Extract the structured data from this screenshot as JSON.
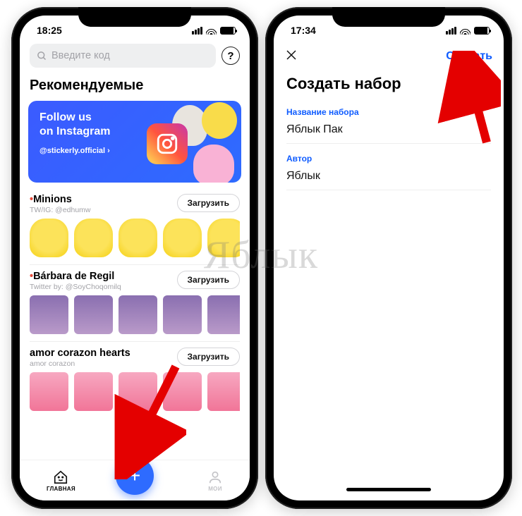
{
  "watermark": "Яблык",
  "left": {
    "status_time": "18:25",
    "search_placeholder": "Введите код",
    "section_recommended": "Рекомендуемые",
    "promo": {
      "line1": "Follow us",
      "line2": "on Instagram",
      "handle": "@stickerly.official ›"
    },
    "packs": [
      {
        "title": "Minions",
        "sub": "TW/IG: @edhumw",
        "button": "Загрузить"
      },
      {
        "title": "Bárbara de Regil",
        "sub": "Twitter by: @SoyChoqomilq",
        "button": "Загрузить"
      },
      {
        "title": "amor corazon hearts",
        "sub": "amor corazon",
        "button": "Загрузить"
      }
    ],
    "tabs": {
      "home": "ГЛАВНАЯ",
      "mine": "МОИ"
    }
  },
  "right": {
    "status_time": "17:34",
    "create": "Создать",
    "title": "Создать набор",
    "field_name_label": "Название набора",
    "field_name_value": "Яблык Пак",
    "field_author_label": "Автор",
    "field_author_value": "Яблык"
  }
}
